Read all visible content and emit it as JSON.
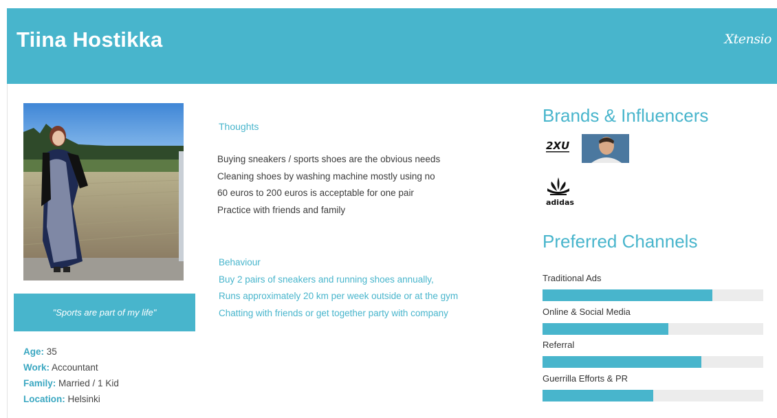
{
  "header": {
    "name": "Tiina Hostikka",
    "brand": "Xtensio"
  },
  "profile": {
    "quote": "\"Sports are part of my life\"",
    "facts": [
      {
        "key": "Age",
        "value": "35"
      },
      {
        "key": "Work",
        "value": "Accountant"
      },
      {
        "key": "Family",
        "value": "Married / 1 Kid"
      },
      {
        "key": "Location",
        "value": "Helsinki"
      }
    ]
  },
  "thoughts": {
    "title": "Thoughts",
    "lines": [
      "Buying sneakers / sports shoes are the obvious needs",
      "Cleaning shoes by washing machine mostly using no",
      "60 euros to 200 euros is acceptable for one pair",
      "Practice with friends and family"
    ]
  },
  "behaviour": {
    "title": "Behaviour",
    "lines": [
      "Buy 2 pairs of sneakers and running shoes annually,",
      "Runs approximately 20 km per week outside or at the gym",
      "Chatting with friends or get together party with company"
    ]
  },
  "brands": {
    "title": "Brands & Influencers",
    "logos": [
      {
        "icon": "2xu-logo",
        "text": "2XU"
      },
      {
        "icon": "influencer-photo"
      },
      {
        "icon": "adidas-logo",
        "text": "adidas"
      }
    ]
  },
  "channels": {
    "title": "Preferred Channels",
    "items": [
      {
        "label": "Traditional Ads",
        "value": 0.77
      },
      {
        "label": "Online & Social Media",
        "value": 0.57
      },
      {
        "label": "Referral",
        "value": 0.72
      },
      {
        "label": "Guerrilla Efforts & PR",
        "value": 0.5
      }
    ]
  },
  "colors": {
    "accent": "#48b5cc",
    "track": "#ececec"
  }
}
